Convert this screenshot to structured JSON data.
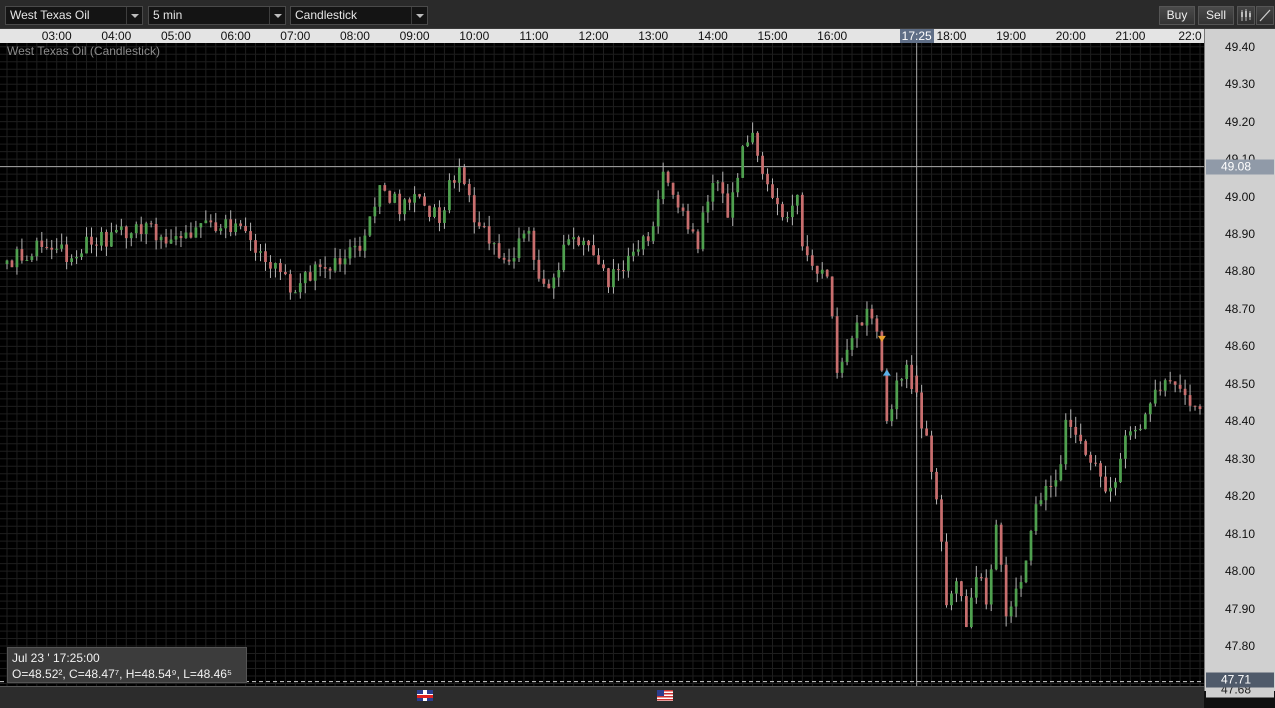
{
  "toolbar": {
    "instrument": "West Texas Oil",
    "interval": "5 min",
    "chart_type": "Candlestick",
    "buy_label": "Buy",
    "sell_label": "Sell"
  },
  "chart_title": "West Texas Oil (Candlestick)",
  "time_labels": [
    "03:00",
    "04:00",
    "05:00",
    "06:00",
    "07:00",
    "08:00",
    "09:00",
    "10:00",
    "11:00",
    "12:00",
    "13:00",
    "14:00",
    "15:00",
    "16:00",
    "18:00",
    "19:00",
    "20:00",
    "21:00",
    "22:0"
  ],
  "cursor_time": "17:25",
  "price_labels": [
    "49.40",
    "49.30",
    "49.20",
    "49.10",
    "49.00",
    "48.90",
    "48.80",
    "48.70",
    "48.60",
    "48.50",
    "48.40",
    "48.30",
    "48.20",
    "48.10",
    "48.00",
    "47.90",
    "47.80"
  ],
  "current_price": "49.08",
  "marker_price": "47.71",
  "low_price": "47.68",
  "info": {
    "datetime": "Jul 23 ' 17:25:00",
    "ohlc": "O=48.52², C=48.47⁷, H=48.54⁹, L=48.46⁵"
  },
  "colors": {
    "up": "#4fa04f",
    "down": "#c86e6e",
    "background": "#000000",
    "sell_signal": "#e8a030",
    "buy_signal": "#5ab0e8"
  },
  "chart_data": {
    "type": "candlestick",
    "title": "West Texas Oil (Candlestick)",
    "interval_minutes": 5,
    "x_range": [
      "02:10",
      "22:10"
    ],
    "ylim": [
      47.68,
      49.41
    ],
    "grid": true,
    "horizontal_line": 49.08,
    "cursor": {
      "time": "17:25",
      "open": 48.522,
      "close": 48.477,
      "high": 48.549,
      "low": 48.465
    },
    "signals": [
      {
        "type": "sell",
        "time": "16:50",
        "price": 48.62
      },
      {
        "type": "buy",
        "time": "16:55",
        "price": 48.53
      }
    ],
    "anchors": [
      [
        "02:10",
        48.82
      ],
      [
        "02:40",
        48.86
      ],
      [
        "03:00",
        48.87
      ],
      [
        "03:20",
        48.84
      ],
      [
        "03:40",
        48.88
      ],
      [
        "04:00",
        48.89
      ],
      [
        "04:30",
        48.91
      ],
      [
        "05:00",
        48.89
      ],
      [
        "05:30",
        48.92
      ],
      [
        "06:00",
        48.93
      ],
      [
        "06:15",
        48.9
      ],
      [
        "06:30",
        48.86
      ],
      [
        "06:50",
        48.8
      ],
      [
        "07:00",
        48.75
      ],
      [
        "07:20",
        48.8
      ],
      [
        "07:40",
        48.82
      ],
      [
        "08:00",
        48.84
      ],
      [
        "08:15",
        48.88
      ],
      [
        "08:30",
        49.03
      ],
      [
        "08:50",
        48.97
      ],
      [
        "09:10",
        48.99
      ],
      [
        "09:30",
        48.95
      ],
      [
        "09:50",
        49.09
      ],
      [
        "10:00",
        48.98
      ],
      [
        "10:20",
        48.88
      ],
      [
        "10:40",
        48.83
      ],
      [
        "11:00",
        48.9
      ],
      [
        "11:10",
        48.8
      ],
      [
        "11:20",
        48.76
      ],
      [
        "11:40",
        48.89
      ],
      [
        "12:00",
        48.85
      ],
      [
        "12:10",
        48.82
      ],
      [
        "12:20",
        48.78
      ],
      [
        "12:40",
        48.82
      ],
      [
        "13:00",
        48.9
      ],
      [
        "13:10",
        48.98
      ],
      [
        "13:15",
        49.06
      ],
      [
        "13:30",
        48.98
      ],
      [
        "13:50",
        48.88
      ],
      [
        "14:00",
        49.0
      ],
      [
        "14:10",
        49.05
      ],
      [
        "14:20",
        48.96
      ],
      [
        "14:35",
        49.12
      ],
      [
        "14:45",
        49.18
      ],
      [
        "14:55",
        49.05
      ],
      [
        "15:10",
        48.97
      ],
      [
        "15:20",
        48.93
      ],
      [
        "15:30",
        49.02
      ],
      [
        "15:35",
        48.88
      ],
      [
        "15:45",
        48.8
      ],
      [
        "16:00",
        48.78
      ],
      [
        "16:10",
        48.55
      ],
      [
        "16:20",
        48.6
      ],
      [
        "16:30",
        48.64
      ],
      [
        "16:40",
        48.7
      ],
      [
        "16:50",
        48.65
      ],
      [
        "17:00",
        48.4
      ],
      [
        "17:10",
        48.5
      ],
      [
        "17:20",
        48.55
      ],
      [
        "17:25",
        48.47
      ],
      [
        "17:40",
        48.35
      ],
      [
        "17:55",
        48.1
      ],
      [
        "18:00",
        47.92
      ],
      [
        "18:10",
        47.97
      ],
      [
        "18:20",
        47.85
      ],
      [
        "18:30",
        48.0
      ],
      [
        "18:40",
        47.92
      ],
      [
        "18:50",
        48.12
      ],
      [
        "19:00",
        47.87
      ],
      [
        "19:10",
        47.93
      ],
      [
        "19:20",
        48.05
      ],
      [
        "19:30",
        48.2
      ],
      [
        "19:50",
        48.24
      ],
      [
        "20:00",
        48.38
      ],
      [
        "20:15",
        48.36
      ],
      [
        "20:30",
        48.28
      ],
      [
        "20:45",
        48.2
      ],
      [
        "21:00",
        48.37
      ],
      [
        "21:20",
        48.41
      ],
      [
        "21:40",
        48.51
      ],
      [
        "22:00",
        48.46
      ],
      [
        "22:10",
        48.43
      ]
    ]
  }
}
